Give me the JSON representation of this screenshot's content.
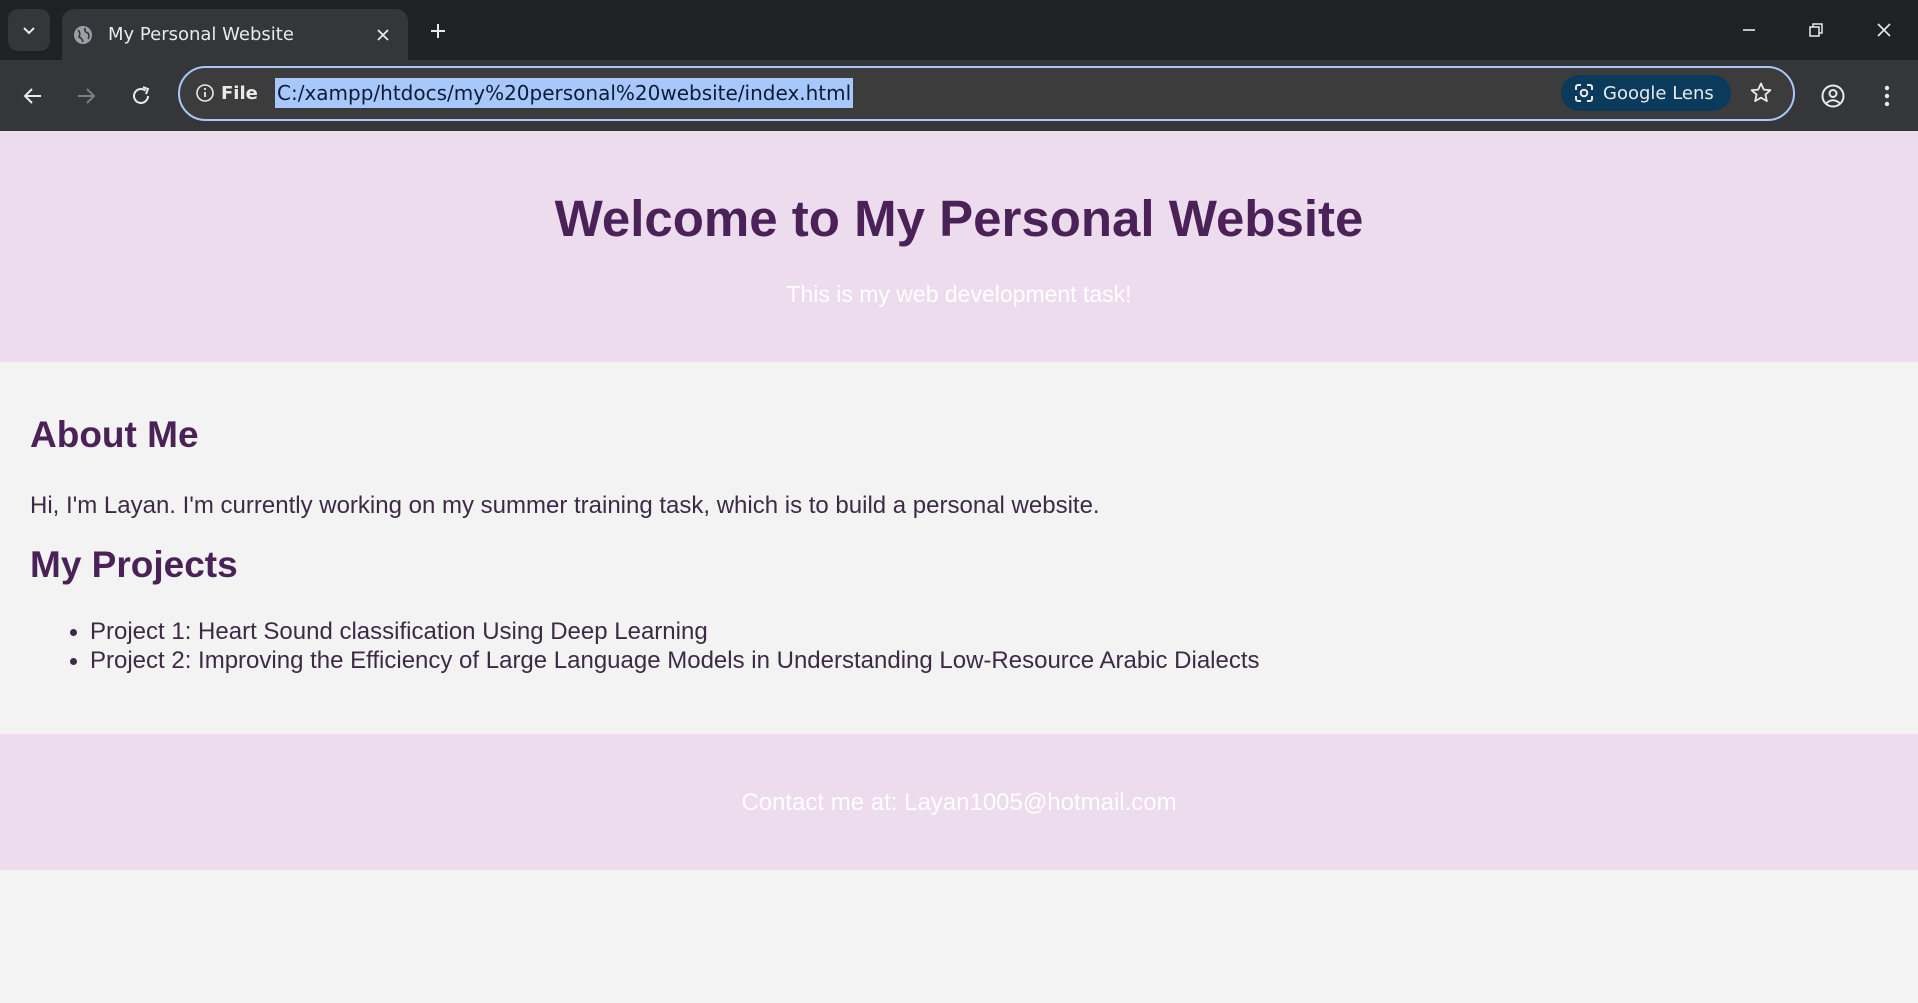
{
  "browser": {
    "tab": {
      "title": "My Personal Website"
    },
    "omnibox": {
      "site_info_label": "File",
      "url": "C:/xampp/htdocs/my%20personal%20website/index.html",
      "lens_label": "Google Lens"
    },
    "colors": {
      "tabbar": "#202124",
      "toolbar": "#35363a",
      "url_highlight": "#a8c7fa"
    }
  },
  "page": {
    "header": {
      "title": "Welcome to My Personal Website",
      "subtitle": "This is my web development task!"
    },
    "about": {
      "heading": "About Me",
      "text": "Hi, I'm Layan. I'm currently working on my summer training task, which is to build a personal website."
    },
    "projects": {
      "heading": "My Projects",
      "items": [
        "Project 1: Heart Sound classification Using Deep Learning",
        "Project 2: Improving the Efficiency of Large Language Models in Understanding Low-Resource Arabic Dialects"
      ]
    },
    "footer": {
      "text": "Contact me at: Layan1005@hotmail.com"
    },
    "colors": {
      "accent": "#4a2257",
      "band": "#eddcee",
      "background": "#f3f3f3"
    }
  }
}
